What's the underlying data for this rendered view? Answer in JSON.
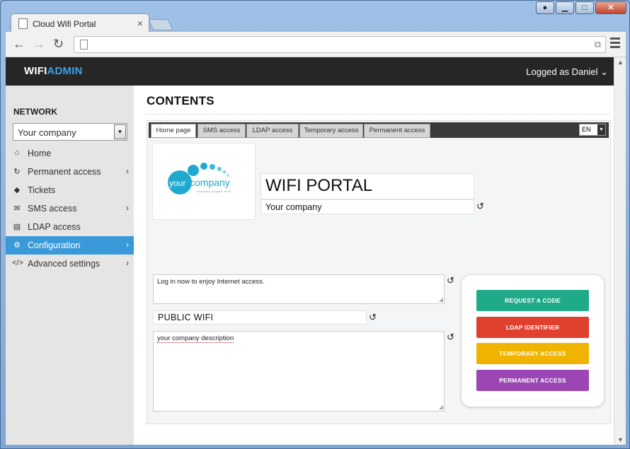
{
  "browser": {
    "tab_title": "Cloud Wifi Portal",
    "tab_close": "×",
    "back_icon": "arrow-left-icon",
    "forward_icon": "arrow-right-icon",
    "reload_icon": "reload-icon",
    "address_value": ""
  },
  "header": {
    "brand_wifi": "WIFI",
    "brand_admin": "ADMIN",
    "logged_as": "Logged as Daniel",
    "accent_color": "#3aa0e8"
  },
  "sidebar": {
    "section_label": "NETWORK",
    "company_select": "Your company",
    "items": [
      {
        "label": "Home",
        "icon": "home-icon",
        "glyph": "⌂",
        "chevron": ""
      },
      {
        "label": "Permanent access",
        "icon": "refresh-icon",
        "glyph": "↻",
        "chevron": "›"
      },
      {
        "label": "Tickets",
        "icon": "tag-icon",
        "glyph": "◆",
        "chevron": ""
      },
      {
        "label": "SMS access",
        "icon": "envelope-icon",
        "glyph": "✉",
        "chevron": "›"
      },
      {
        "label": "LDAP access",
        "icon": "book-icon",
        "glyph": "▤",
        "chevron": ""
      },
      {
        "label": "Configuration",
        "icon": "gears-icon",
        "glyph": "⚙",
        "chevron": "›",
        "active": true
      },
      {
        "label": "Advanced settings",
        "icon": "code-icon",
        "glyph": "</>",
        "chevron": "›"
      }
    ],
    "active_color": "#3a9ad9"
  },
  "main": {
    "title": "CONTENTS",
    "tabs": [
      "Home page",
      "SMS access",
      "LDAP access",
      "Temporary access",
      "Permanent access"
    ],
    "lang": "EN",
    "logo_text_1": "your",
    "logo_text_2": "company",
    "logo_slogan": "company slogan here",
    "portal_title": "WIFI PORTAL",
    "portal_subtitle": "Your company",
    "login_message": "Log in now to enjoy Internet access.",
    "wifi_name": "PUBLIC WIFI",
    "description": "your company description",
    "buttons": [
      {
        "label": "REQUEST A CODE",
        "color": "#1fab8a"
      },
      {
        "label": "LDAP IDENTIFIER",
        "color": "#e0412f"
      },
      {
        "label": "TEMPORARY ACCESS",
        "color": "#f0b400"
      },
      {
        "label": "PERMANENT ACCESS",
        "color": "#9b46b4"
      }
    ]
  }
}
